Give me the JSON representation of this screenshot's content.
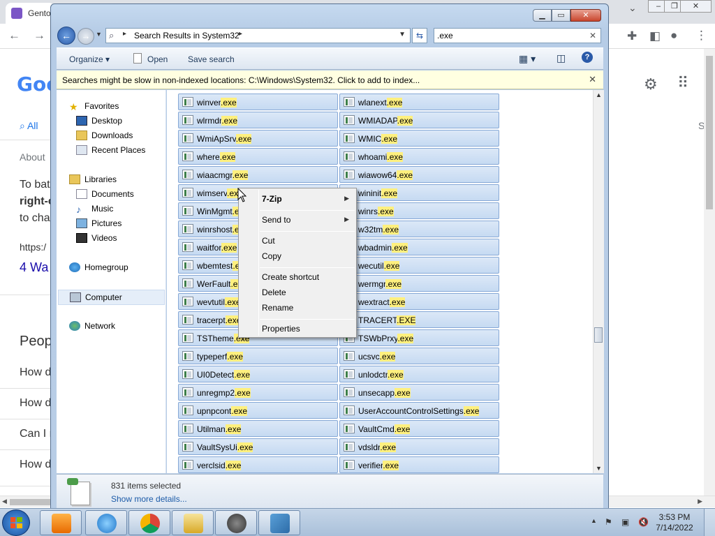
{
  "browser": {
    "tab_title": "Gento",
    "google_logo": "Goo",
    "tab_all": "All",
    "about": "About",
    "para_line1": "To bat",
    "para_line2": "right-c",
    "para_line3": "to cha",
    "url_frag": "https:/",
    "link": "4 Wa",
    "people": "Peop",
    "q1": "How d",
    "q2": "How d",
    "q3": "Can I r",
    "q4": "How d",
    "right_frag": "S"
  },
  "explorer": {
    "address_path": "Search Results in System32",
    "search_value": ".exe",
    "toolbar": {
      "organize": "Organize",
      "open": "Open",
      "save_search": "Save search"
    },
    "infobar": "Searches might be slow in non-indexed locations: C:\\Windows\\System32. Click to add to index...",
    "nav": {
      "favorites": "Favorites",
      "desktop": "Desktop",
      "downloads": "Downloads",
      "recent_places": "Recent Places",
      "libraries": "Libraries",
      "documents": "Documents",
      "music": "Music",
      "pictures": "Pictures",
      "videos": "Videos",
      "homegroup": "Homegroup",
      "computer": "Computer",
      "network": "Network"
    },
    "files": [
      [
        "winver",
        ".exe"
      ],
      [
        "wlanext",
        ".exe"
      ],
      [
        "wlrmdr",
        ".exe"
      ],
      [
        "WMIADAP",
        ".exe"
      ],
      [
        "WmiApSrv",
        ".exe"
      ],
      [
        "WMIC",
        ".exe"
      ],
      [
        "where",
        ".exe"
      ],
      [
        "whoami",
        ".exe"
      ],
      [
        "wiaacmgr",
        ".exe"
      ],
      [
        "wiawow64",
        ".exe"
      ],
      [
        "wimserv",
        ".exe"
      ],
      [
        "wininit",
        ".exe"
      ],
      [
        "WinMgmt",
        ".exe"
      ],
      [
        "winrs",
        ".exe"
      ],
      [
        "winrshost",
        ".exe"
      ],
      [
        "w32tm",
        ".exe"
      ],
      [
        "waitfor",
        ".exe"
      ],
      [
        "wbadmin",
        ".exe"
      ],
      [
        "wbemtest",
        ".exe"
      ],
      [
        "wecutil",
        ".exe"
      ],
      [
        "WerFault",
        ".exe"
      ],
      [
        "wermgr",
        ".exe"
      ],
      [
        "wevtutil",
        ".exe"
      ],
      [
        "wextract",
        ".exe"
      ],
      [
        "tracerpt",
        ".exe"
      ],
      [
        "TRACERT",
        ".EXE"
      ],
      [
        "TSTheme",
        ".exe"
      ],
      [
        "TSWbPrxy",
        ".exe"
      ],
      [
        "typeperf",
        ".exe"
      ],
      [
        "ucsvc",
        ".exe"
      ],
      [
        "UI0Detect",
        ".exe"
      ],
      [
        "unlodctr",
        ".exe"
      ],
      [
        "unregmp2",
        ".exe"
      ],
      [
        "unsecapp",
        ".exe"
      ],
      [
        "upnpcont",
        ".exe"
      ],
      [
        "UserAccountControlSettings",
        ".exe"
      ],
      [
        "Utilman",
        ".exe"
      ],
      [
        "VaultCmd",
        ".exe"
      ],
      [
        "VaultSysUi",
        ".exe"
      ],
      [
        "vdsldr",
        ".exe"
      ],
      [
        "verclsid",
        ".exe"
      ],
      [
        "verifier",
        ".exe"
      ]
    ],
    "details": {
      "count": "831 items selected",
      "more": "Show more details..."
    }
  },
  "context_menu": {
    "zip": "7-Zip",
    "send_to": "Send to",
    "cut": "Cut",
    "copy": "Copy",
    "create_shortcut": "Create shortcut",
    "delete": "Delete",
    "rename": "Rename",
    "properties": "Properties"
  },
  "taskbar": {
    "time": "3:53 PM",
    "date": "7/14/2022"
  }
}
